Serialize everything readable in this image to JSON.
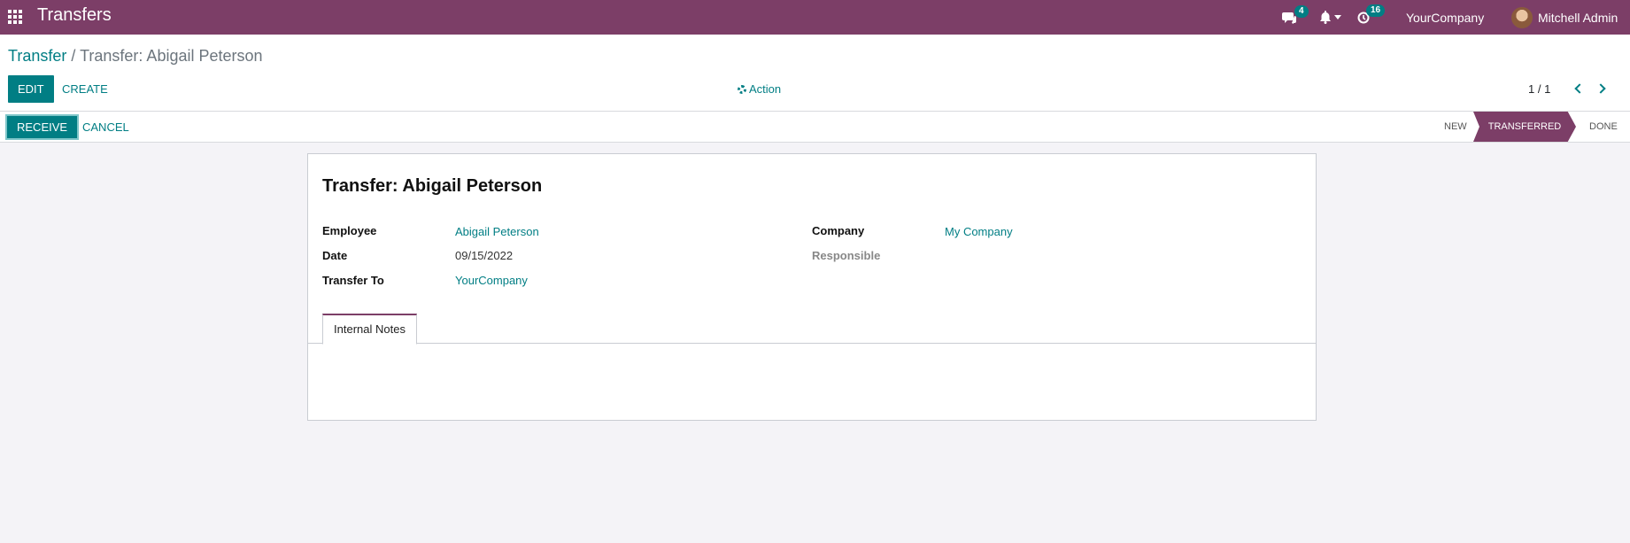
{
  "navbar": {
    "app_title": "Transfers",
    "messages_count": "4",
    "activities_count": "16",
    "company": "YourCompany",
    "user": "Mitchell Admin",
    "brand_color": "#7c3e67"
  },
  "breadcrumb": {
    "parent": "Transfer",
    "separator": "/",
    "current": "Transfer: Abigail Peterson"
  },
  "toolbar": {
    "edit_label": "EDIT",
    "create_label": "CREATE",
    "action_label": "Action",
    "pager": "1 / 1"
  },
  "statusbar": {
    "receive_label": "RECEIVE",
    "cancel_label": "CANCEL",
    "stages": [
      "NEW",
      "TRANSFERRED",
      "DONE"
    ],
    "active_stage": "TRANSFERRED"
  },
  "form": {
    "title": "Transfer: Abigail Peterson",
    "employee_label": "Employee",
    "employee_value": "Abigail Peterson",
    "date_label": "Date",
    "date_value": "09/15/2022",
    "transfer_to_label": "Transfer To",
    "transfer_to_value": "YourCompany",
    "company_label": "Company",
    "company_value": "My Company",
    "responsible_label": "Responsible",
    "tab_label": "Internal Notes"
  },
  "accent_color": "#017e84"
}
